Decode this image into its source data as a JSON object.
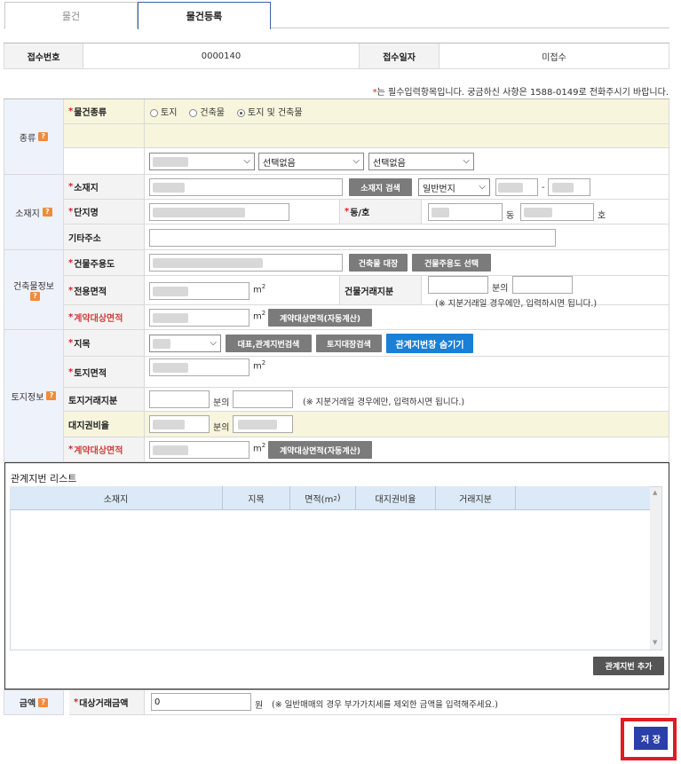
{
  "tabs": [
    "물건",
    "물건등록"
  ],
  "receipt": {
    "no_label": "접수번호",
    "no_value": "0000140",
    "date_label": "접수일자",
    "date_value": "미접수"
  },
  "notice": "는 필수입력항목입니다. 궁금하신 사항은 1588-0149로 전화주시기 바랍니다.",
  "sections": {
    "type": "종류",
    "location": "소재지",
    "building": "건축물정보",
    "land": "토지정보",
    "amount": "금액"
  },
  "type": {
    "label": "물건종류",
    "options": [
      "토지",
      "건축물",
      "토지 및 건축물"
    ],
    "selected": 2,
    "select2": "선택없음",
    "select3": "선택없음"
  },
  "location": {
    "addr_label": "소재지",
    "search_btn": "소재지 검색",
    "lot_type": "일반번지",
    "dash": "-",
    "complex_label": "단지명",
    "dongho_label": "동/호",
    "dong_unit": "동",
    "ho_unit": "호",
    "etc_label": "기타주소"
  },
  "building": {
    "use_label": "건물주용도",
    "ledger_btn": "건축물 대장",
    "use_btn": "건물주용도 선택",
    "area_label": "전용면적",
    "unit": "m",
    "unit_sup": "2",
    "share_label": "건물거래지분",
    "share_sep": "분의",
    "share_note": "(※ 지분거래일 경우에만, 입력하시면 됩니다.)",
    "contract_label": "계약대상면적",
    "auto_btn": "계약대상면적(자동계산)"
  },
  "land": {
    "jimok_label": "지목",
    "rep_btn": "대표,관계지번검색",
    "ledger_btn": "토지대장검색",
    "toggle_btn": "관계지번창 숨기기",
    "area_label": "토지면적",
    "share_label": "토지거래지분",
    "share_sep": "분의",
    "share_note": "(※ 지분거래일 경우에만, 입력하시면 됩니다.)",
    "ratio_label": "대지권비율",
    "ratio_sep": "분의",
    "contract_label": "계약대상면적",
    "auto_btn": "계약대상면적(자동계산)"
  },
  "rel_list": {
    "title": "관계지번 리스트",
    "columns": [
      "소재지",
      "지목",
      "면적(m",
      "대지권비율",
      "거래지분"
    ],
    "area_sup": "2",
    "close_paren": ")",
    "add_btn": "관계지번 추가"
  },
  "amount": {
    "label": "대상거래금액",
    "value": "0",
    "unit": "원",
    "note": "(※ 일반매매의 경우 부가가치세를 제외한 금액을 입력해주세요.)"
  },
  "save_btn": "저 장",
  "help_icon": "?",
  "colors": {
    "accent": "#2b3fa8",
    "highlight": "#e01b24",
    "yellow_row": "#f7f5dc"
  }
}
